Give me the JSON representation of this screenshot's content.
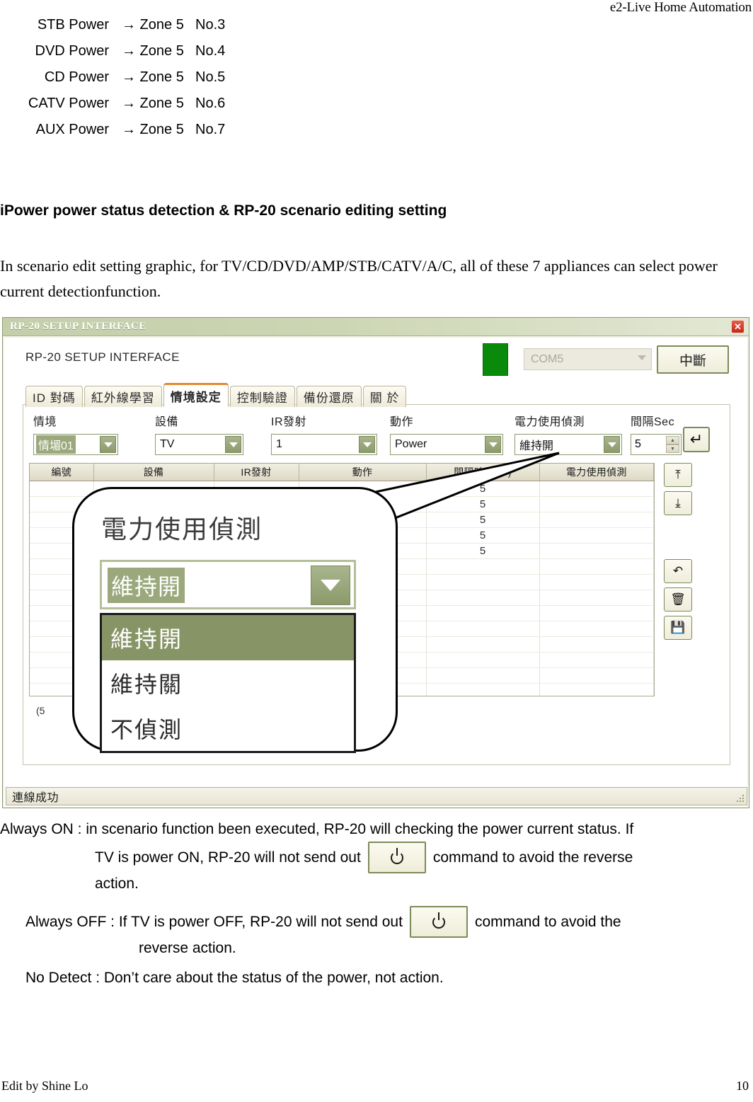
{
  "document": {
    "running_header": "e2-Live Home Automation",
    "footer_left": "Edit by Shine Lo",
    "page_number": "10",
    "section_heading": "iPower power status detection & RP-20 scenario editing setting",
    "intro_paragraph": "In scenario edit setting graphic, for TV/CD/DVD/AMP/STB/CATV/A/C, all of these 7 appliances can select power current detectionfunction."
  },
  "zone_list": [
    {
      "name": "STB Power",
      "arrow": "→ Zone 5",
      "no": "No.3"
    },
    {
      "name": "DVD Power",
      "arrow": "→ Zone 5",
      "no": "No.4"
    },
    {
      "name": "CD Power",
      "arrow": "→ Zone 5",
      "no": "No.5"
    },
    {
      "name": "CATV Power",
      "arrow": "→ Zone 5",
      "no": "No.6"
    },
    {
      "name": "AUX Power",
      "arrow": "→ Zone 5",
      "no": "No.7"
    }
  ],
  "app": {
    "title_bar": "RP-20 SETUP INTERFACE",
    "close_label": "✕",
    "subtitle": "RP-20 SETUP INTERFACE",
    "com_port_value": "COM5",
    "disconnect_button": "中斷",
    "connection_color": "#0a8a0a",
    "tabs": [
      {
        "label": "ID 對碼",
        "active": false
      },
      {
        "label": "紅外線學習",
        "active": false
      },
      {
        "label": "情境設定",
        "active": true
      },
      {
        "label": "控制驗證",
        "active": false
      },
      {
        "label": "備份還原",
        "active": false
      },
      {
        "label": "關 於",
        "active": false
      }
    ],
    "form": {
      "fields": [
        {
          "label": "情境",
          "value": "情堳01",
          "selected": true
        },
        {
          "label": "設備",
          "value": "TV",
          "selected": false
        },
        {
          "label": "IR發射",
          "value": "1",
          "selected": false
        },
        {
          "label": "動作",
          "value": "Power",
          "selected": false
        },
        {
          "label": "電力使用偵測",
          "value": "維持開",
          "selected": false
        }
      ],
      "interval_label": "間隔Sec",
      "interval_value": "5",
      "enter_button": "↵"
    },
    "grid": {
      "columns": [
        "編號",
        "設備",
        "IR發射",
        "動作",
        "間隔時間(秒)",
        "電力使用偵測"
      ],
      "rows": [
        {
          "no": "",
          "device": "",
          "ir": "",
          "action": "",
          "interval": "5",
          "detect": ""
        },
        {
          "no": "",
          "device": "",
          "ir": "",
          "action": "",
          "interval": "5",
          "detect": ""
        },
        {
          "no": "",
          "device": "",
          "ir": "",
          "action": "",
          "interval": "5",
          "detect": ""
        },
        {
          "no": "",
          "device": "",
          "ir": "",
          "action": "",
          "interval": "5",
          "detect": ""
        },
        {
          "no": "",
          "device": "",
          "ir": "",
          "action": "",
          "interval": "5",
          "detect": ""
        }
      ],
      "empty_row_count": 10
    },
    "tool_buttons": [
      {
        "name": "move-to-top",
        "glyph": "⤒"
      },
      {
        "name": "move-to-bottom",
        "glyph": "⤓"
      },
      {
        "name": "undo",
        "glyph": "↶"
      },
      {
        "name": "delete",
        "glyph": "🗑"
      },
      {
        "name": "save",
        "glyph": "💾"
      }
    ],
    "footnote": "(5",
    "status_text": "連線成功"
  },
  "callout": {
    "title": "電力使用偵測",
    "selected_value": "維持開",
    "options": [
      {
        "label": "維持開",
        "highlighted": true
      },
      {
        "label": "維持關",
        "highlighted": false
      },
      {
        "label": "不偵測",
        "highlighted": false
      }
    ]
  },
  "explanation": {
    "line1": "Always ON : in scenario function been executed, RP-20 will checking the power current status. If",
    "line2_before": "TV is power ON, RP-20 will not send out",
    "line2_after": "command    to avoid the reverse",
    "line3": "action.",
    "line4_before": "Always OFF : If TV is power OFF, RP-20 will not send out",
    "line4_after": "command    to avoid the",
    "line5": "reverse action.",
    "line6": "No Detect : Don’t care about the status of the power, not action."
  }
}
